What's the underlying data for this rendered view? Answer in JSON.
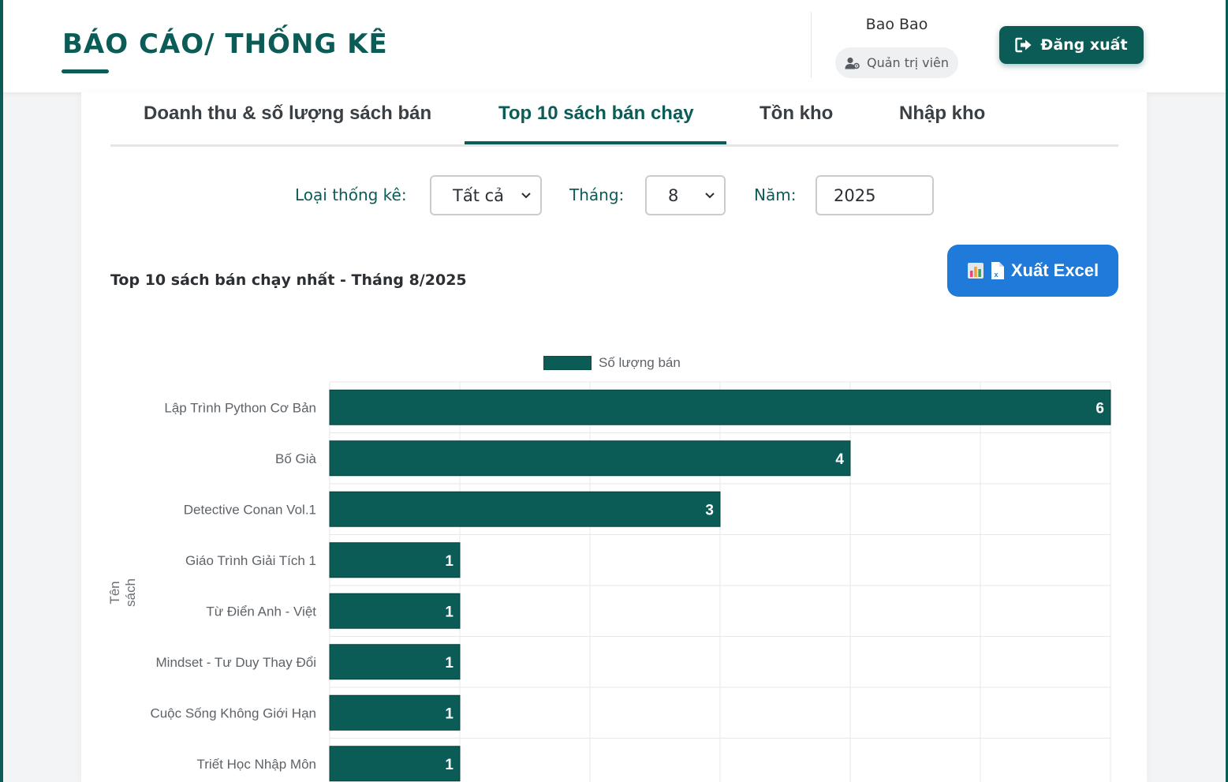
{
  "header": {
    "title": "BÁO CÁO/ THỐNG KÊ",
    "user_name": "Bao Bao",
    "role": "Quản trị viên",
    "logout_label": "Đăng xuất"
  },
  "tabs": [
    {
      "label": "Doanh thu & số lượng sách bán",
      "active": false
    },
    {
      "label": "Top 10 sách bán chạy",
      "active": true
    },
    {
      "label": "Tồn kho",
      "active": false
    },
    {
      "label": "Nhập kho",
      "active": false
    }
  ],
  "filters": {
    "type_label": "Loại thống kê:",
    "type_value": "Tất cả",
    "month_label": "Tháng:",
    "month_value": "8",
    "year_label": "Năm:",
    "year_value": "2025"
  },
  "chart_heading": "Top 10 sách bán chạy nhất - Tháng 8/2025",
  "export_label": "Xuất Excel",
  "icons": {
    "role": "user-cog-icon",
    "logout": "sign-out-icon",
    "excel": [
      "bar-chart-icon",
      "excel-file-icon"
    ],
    "select": "chevron-down-icon"
  },
  "colors": {
    "primary": "#0b5c57",
    "accent_blue": "#1f7ad9"
  },
  "chart_data": {
    "type": "bar",
    "orientation": "horizontal",
    "categories": [
      "Lập Trình Python Cơ Bản",
      "Bố Già",
      "Detective Conan Vol.1",
      "Giáo Trình Giải Tích 1",
      "Từ Điển Anh - Việt",
      "Mindset - Tư Duy Thay Đổi",
      "Cuộc Sống Không Giới Hạn",
      "Triết Học Nhập Môn"
    ],
    "series": [
      {
        "name": "Số lượng bán",
        "values": [
          6,
          4,
          3,
          1,
          1,
          1,
          1,
          1
        ],
        "color": "#0b5c57"
      }
    ],
    "ylabel": "Tên sách",
    "xlim": [
      0,
      6
    ],
    "grid": true,
    "legend_position": "top-center",
    "data_labels": true
  }
}
